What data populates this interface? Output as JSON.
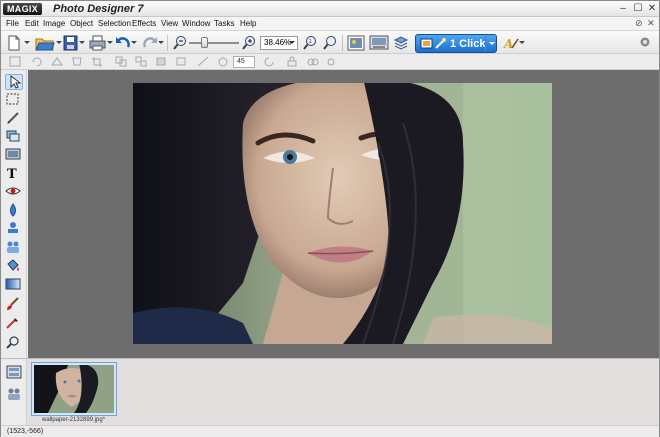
{
  "app": {
    "logo": "MAGIX",
    "title": "Photo Designer 7"
  },
  "window_controls": {
    "minimize": "–",
    "maximize": "☐",
    "close": "✕"
  },
  "menu": {
    "items": [
      "File",
      "Edit",
      "Image",
      "Object",
      "Selection",
      "Effects",
      "View",
      "Window",
      "Tasks",
      "Help"
    ],
    "doc_controls": [
      "⊘",
      "✕"
    ]
  },
  "toolbar": {
    "zoom_value": "38.46%",
    "one_click_label": "1 Click",
    "icons": [
      "new-document-icon",
      "open-folder-icon",
      "save-icon",
      "print-icon",
      "undo-icon",
      "redo-icon",
      "zoom-out-icon",
      "zoom-slider",
      "zoom-in-icon",
      "zoom-fit-icon",
      "photo-effects-icon",
      "gallery-icon",
      "layers-icon",
      "one-click-icon",
      "text-art-icon",
      "help-icon"
    ]
  },
  "toolbar2": {
    "angle_value": "45"
  },
  "tools": [
    "pointer-tool-icon",
    "marquee-tool-icon",
    "pen-tool-icon",
    "layer-tool-icon",
    "image-tool-icon",
    "text-tool-icon",
    "red-eye-tool-icon",
    "drop-tool-icon",
    "stamp-tool-icon",
    "people-tool-icon",
    "fill-tool-icon",
    "gradient-tool-icon",
    "brush-tool-icon",
    "eyedropper-tool-icon",
    "magnifier-tool-icon"
  ],
  "filmstrip": {
    "items": [
      {
        "name": "wallpaper-2132899.jpg*"
      }
    ]
  },
  "status": {
    "coords": "(1523,-566)"
  }
}
